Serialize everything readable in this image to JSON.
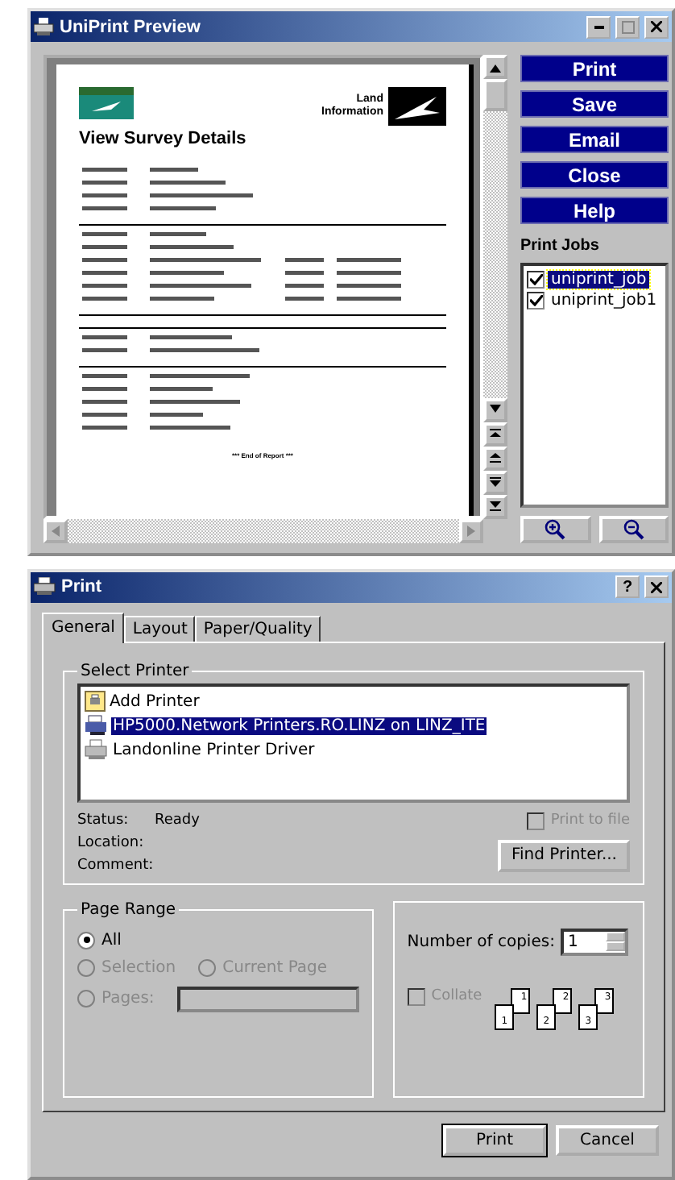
{
  "preview_window": {
    "title": "UniPrint Preview",
    "document": {
      "heading": "View Survey Details",
      "logo_lines": [
        "Land",
        "Information"
      ],
      "footer": "*** End of Report ***"
    },
    "buttons": [
      "Print",
      "Save",
      "Email",
      "Close",
      "Help"
    ],
    "print_jobs": {
      "label": "Print Jobs",
      "items": [
        {
          "name": "uniprint_job",
          "checked": true,
          "selected": true
        },
        {
          "name": "uniprint_job1",
          "checked": true,
          "selected": false
        }
      ]
    }
  },
  "print_dialog": {
    "title": "Print",
    "help_button": "?",
    "tabs": [
      {
        "label": "General",
        "selected": true
      },
      {
        "label": "Layout",
        "selected": false
      },
      {
        "label": "Paper/Quality",
        "selected": false
      }
    ],
    "select_printer": {
      "label": "Select Printer",
      "printers": [
        {
          "name": "Add Printer",
          "kind": "add",
          "selected": false
        },
        {
          "name": "HP5000.Network Printers.RO.LINZ on LINZ_ITE",
          "kind": "network",
          "selected": true
        },
        {
          "name": "Landonline Printer Driver",
          "kind": "local",
          "selected": false
        }
      ],
      "status_label": "Status:",
      "status": "Ready",
      "location_label": "Location:",
      "comment_label": "Comment:",
      "print_to_file": {
        "label": "Print to file",
        "checked": false,
        "disabled": true
      },
      "find_printer": "Find Printer..."
    },
    "page_range": {
      "label": "Page Range",
      "options": [
        {
          "label": "All",
          "selected": true,
          "disabled": false
        },
        {
          "label": "Selection",
          "selected": false,
          "disabled": true
        },
        {
          "label": "Current Page",
          "selected": false,
          "disabled": true
        },
        {
          "label": "Pages:",
          "selected": false,
          "disabled": true
        }
      ]
    },
    "copies": {
      "label": "Number of copies:",
      "value": "1",
      "collate": {
        "label": "Collate",
        "checked": false,
        "disabled": true
      },
      "stacks": [
        {
          "back": "1",
          "front": "1"
        },
        {
          "back": "2",
          "front": "2"
        },
        {
          "back": "3",
          "front": "3"
        }
      ]
    },
    "buttons": [
      "Print",
      "Cancel"
    ]
  }
}
